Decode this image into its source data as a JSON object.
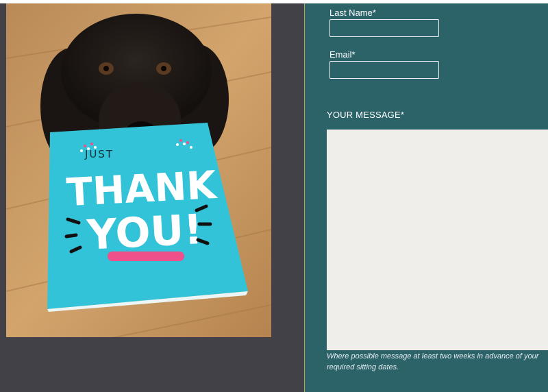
{
  "form": {
    "last_name_label": "Last Name*",
    "last_name_value": "",
    "email_label": "Email*",
    "email_value": "",
    "message_label": "YOUR MESSAGE*",
    "message_value": "",
    "message_hint": "Where possible message at least two weeks in advance of your required sitting dates."
  },
  "image": {
    "card_text_top": "JUST",
    "card_text_main_1": "THANK",
    "card_text_main_2": "YOU!"
  },
  "colors": {
    "panel": "#2b6369",
    "page_bg": "#424147",
    "message_bg": "#efeeeb",
    "card": "#33c3d8",
    "accent_pink": "#f0508a"
  }
}
